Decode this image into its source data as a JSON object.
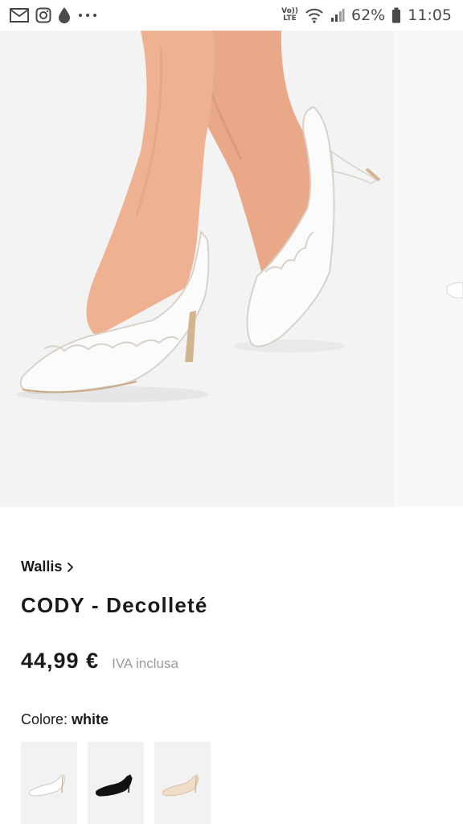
{
  "status_bar": {
    "left_icons": [
      "mail-icon",
      "instagram-icon",
      "drop-icon",
      "more-dots-icon"
    ],
    "network_label": "Vo)) LTE",
    "battery_percent": "62%",
    "time": "11:05"
  },
  "product": {
    "image_alt": "white-scalloped-slingback-pumps",
    "brand": "Wallis",
    "name": "CODY - Decolleté",
    "price": "44,99 €",
    "tax_note": "IVA inclusa",
    "color_label": "Colore:",
    "color_value": "white",
    "swatches": [
      {
        "name": "white",
        "hex": "#ffffff"
      },
      {
        "name": "black",
        "hex": "#111111"
      },
      {
        "name": "nude",
        "hex": "#f1dcc8"
      }
    ]
  }
}
